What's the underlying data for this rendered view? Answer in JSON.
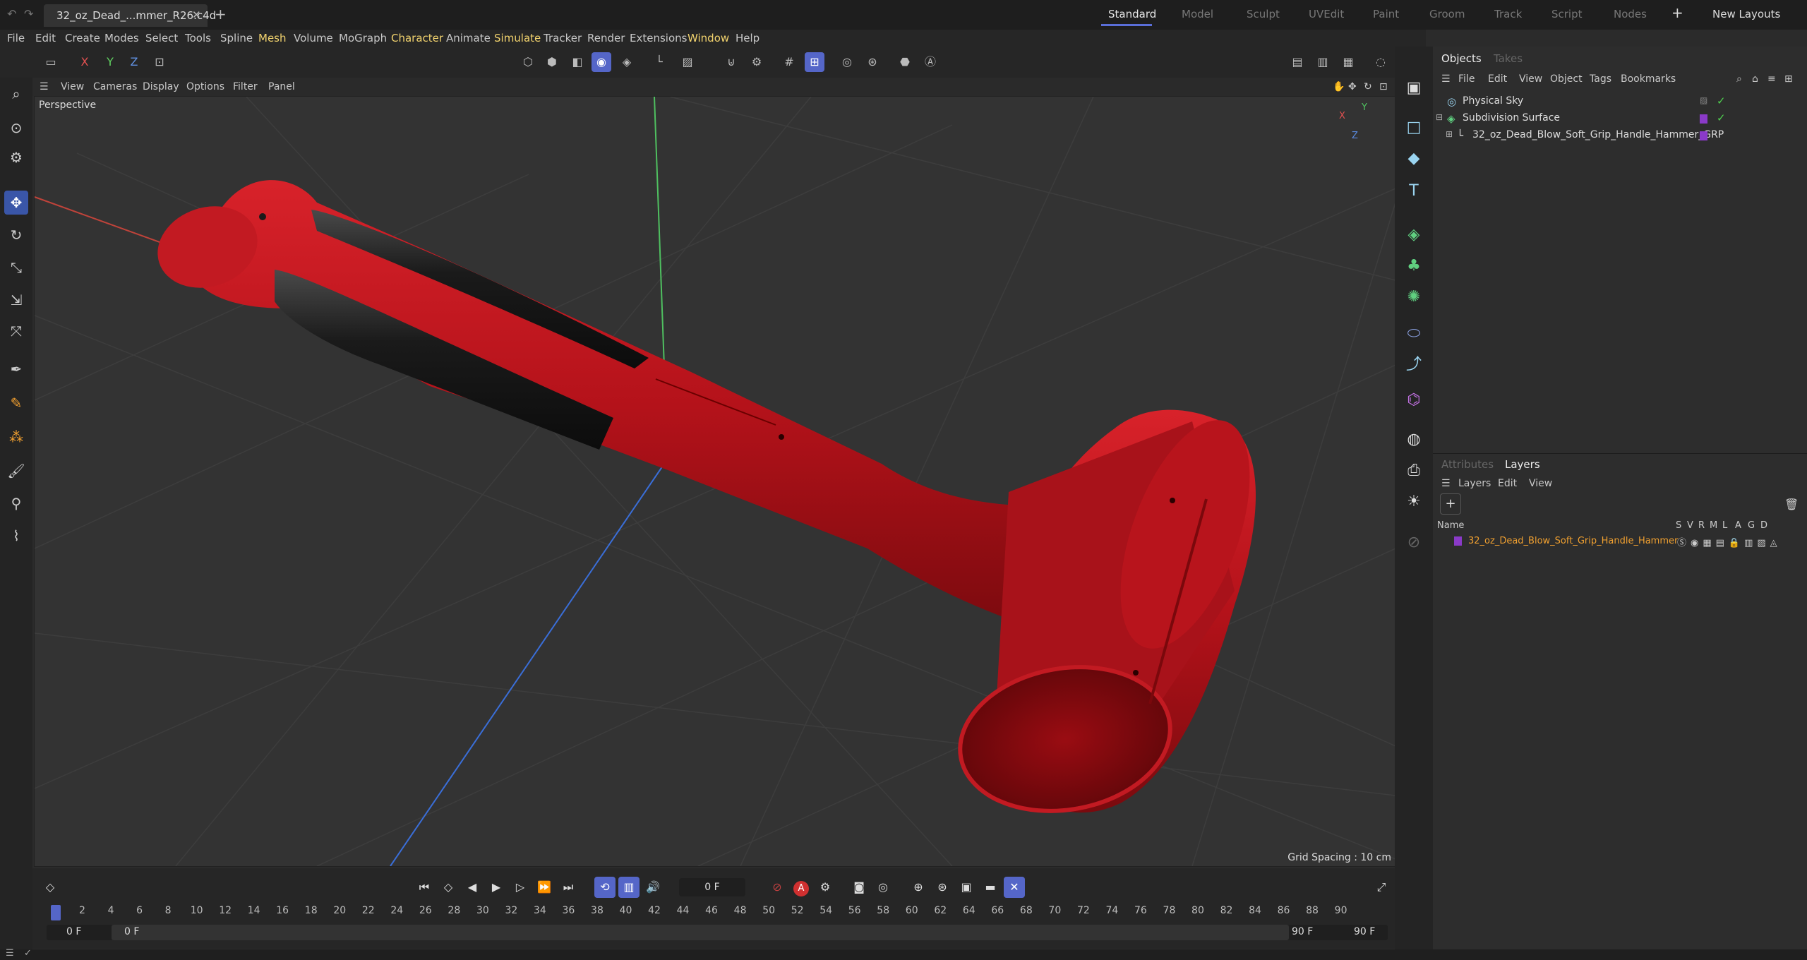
{
  "titlebar": {
    "document_tab": "32_oz_Dead_...mmer_R26.c4d",
    "layouts": [
      {
        "label": "Standard",
        "active": true
      },
      {
        "label": "Model"
      },
      {
        "label": "Sculpt"
      },
      {
        "label": "UVEdit"
      },
      {
        "label": "Paint"
      },
      {
        "label": "Groom"
      },
      {
        "label": "Track"
      },
      {
        "label": "Script"
      },
      {
        "label": "Nodes"
      }
    ],
    "new_layouts": "New Layouts"
  },
  "menubar": [
    "File",
    "Edit",
    "Create",
    "Modes",
    "Select",
    "Tools",
    "Spline",
    "Mesh",
    "Volume",
    "MoGraph",
    "Character",
    "Animate",
    "Simulate",
    "Tracker",
    "Render",
    "Extensions",
    "Window",
    "Help"
  ],
  "axes_buttons": [
    "X",
    "Y",
    "Z"
  ],
  "viewport": {
    "menu": [
      "View",
      "Cameras",
      "Display",
      "Options",
      "Filter",
      "Panel"
    ],
    "label": "Perspective",
    "grid_spacing": "Grid Spacing : 10 cm",
    "axis_x": "X",
    "axis_y": "Y",
    "axis_z": "Z"
  },
  "objects_panel": {
    "tabs": [
      "Objects",
      "Takes"
    ],
    "menu": [
      "File",
      "Edit",
      "View",
      "Object",
      "Tags",
      "Bookmarks"
    ],
    "items": [
      {
        "label": "Physical Sky"
      },
      {
        "label": "Subdivision Surface"
      },
      {
        "label": "32_oz_Dead_Blow_Soft_Grip_Handle_Hammer_GRP"
      }
    ]
  },
  "layers_panel": {
    "tabs": [
      "Attributes",
      "Layers"
    ],
    "menu": [
      "Layers",
      "Edit",
      "View"
    ],
    "column_name": "Name",
    "column_flags": [
      "S",
      "V",
      "R",
      "M",
      "L",
      "A",
      "G",
      "D"
    ],
    "layer_name": "32_oz_Dead_Blow_Soft_Grip_Handle_Hammer"
  },
  "timeline": {
    "current_frame": "0 F",
    "ticks": [
      "0",
      "2",
      "4",
      "6",
      "8",
      "10",
      "12",
      "14",
      "16",
      "18",
      "20",
      "22",
      "24",
      "26",
      "28",
      "30",
      "32",
      "34",
      "36",
      "38",
      "40",
      "42",
      "44",
      "46",
      "48",
      "50",
      "52",
      "54",
      "56",
      "58",
      "60",
      "62",
      "64",
      "66",
      "68",
      "70",
      "72",
      "74",
      "76",
      "78",
      "80",
      "82",
      "84",
      "86",
      "88",
      "90"
    ],
    "start_field": "0 F",
    "start_field2": "0 F",
    "end_field": "90 F",
    "end_field2": "90 F"
  },
  "colors": {
    "accent": "#5566c8",
    "hammer_red": "#c0141c",
    "grip_black": "#1a1a1a",
    "layer_purple": "#8a3ac8",
    "layer_text": "#f0a030"
  }
}
